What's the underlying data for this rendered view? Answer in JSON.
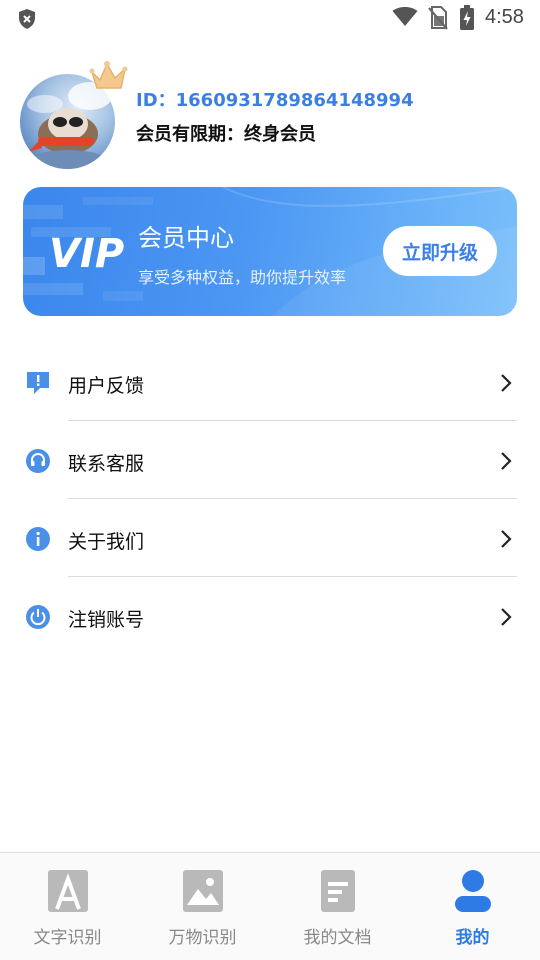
{
  "status_bar": {
    "time": "4:58",
    "icons": [
      "shield-x-icon",
      "wifi-icon",
      "no-sim-icon",
      "battery-charging-icon"
    ]
  },
  "profile": {
    "id_text": "ID：1660931789864148994",
    "member_period": "会员有限期：终身会员",
    "badge_icon": "crown-icon"
  },
  "vip_banner": {
    "logo_text": "VIP",
    "title": "会员中心",
    "subtitle": "享受多种权益，助你提升效率",
    "button_label": "立即升级",
    "colors": {
      "start": "#3a86ec",
      "end": "#7cc0fb",
      "button_text": "#3a80e6"
    }
  },
  "menu": {
    "items": [
      {
        "label": "用户反馈",
        "icon": "feedback-icon"
      },
      {
        "label": "联系客服",
        "icon": "headset-icon"
      },
      {
        "label": "关于我们",
        "icon": "info-icon"
      },
      {
        "label": "注销账号",
        "icon": "power-icon"
      }
    ]
  },
  "bottom_nav": {
    "items": [
      {
        "label": "文字识别",
        "icon": "text-recognition-icon",
        "active": false
      },
      {
        "label": "万物识别",
        "icon": "image-recognition-icon",
        "active": false
      },
      {
        "label": "我的文档",
        "icon": "document-icon",
        "active": false
      },
      {
        "label": "我的",
        "icon": "user-icon",
        "active": true
      }
    ],
    "colors": {
      "active": "#2e7be6",
      "inactive": "#888888"
    }
  }
}
